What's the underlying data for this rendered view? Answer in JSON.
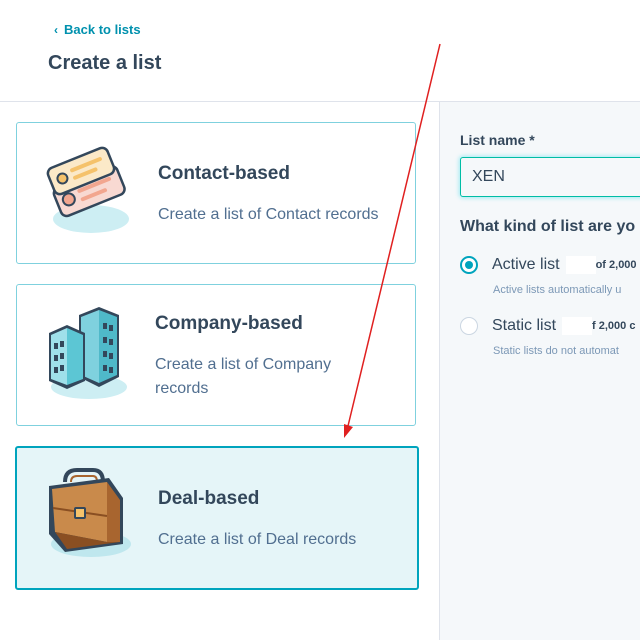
{
  "header": {
    "back_label": "Back to lists",
    "title": "Create a list"
  },
  "cards": [
    {
      "title": "Contact-based",
      "description": "Create a list of Contact records",
      "selected": false
    },
    {
      "title": "Company-based",
      "description": "Create a list of Company records",
      "selected": false
    },
    {
      "title": "Deal-based",
      "description": "Create a list of Deal records",
      "selected": true
    }
  ],
  "form": {
    "list_name_label": "List name *",
    "list_name_value": "XEN",
    "question": "What kind of list are yo",
    "options": [
      {
        "label": "Active list",
        "limit": "of 2,000",
        "help": "Active lists automatically u",
        "checked": true
      },
      {
        "label": "Static list",
        "limit": "f 2,000 c",
        "help": "Static lists do not automat",
        "checked": false
      }
    ]
  },
  "colors": {
    "accent": "#00a4bd",
    "link": "#0091ae",
    "text": "#33475b",
    "annotation_arrow": "#e02020"
  }
}
